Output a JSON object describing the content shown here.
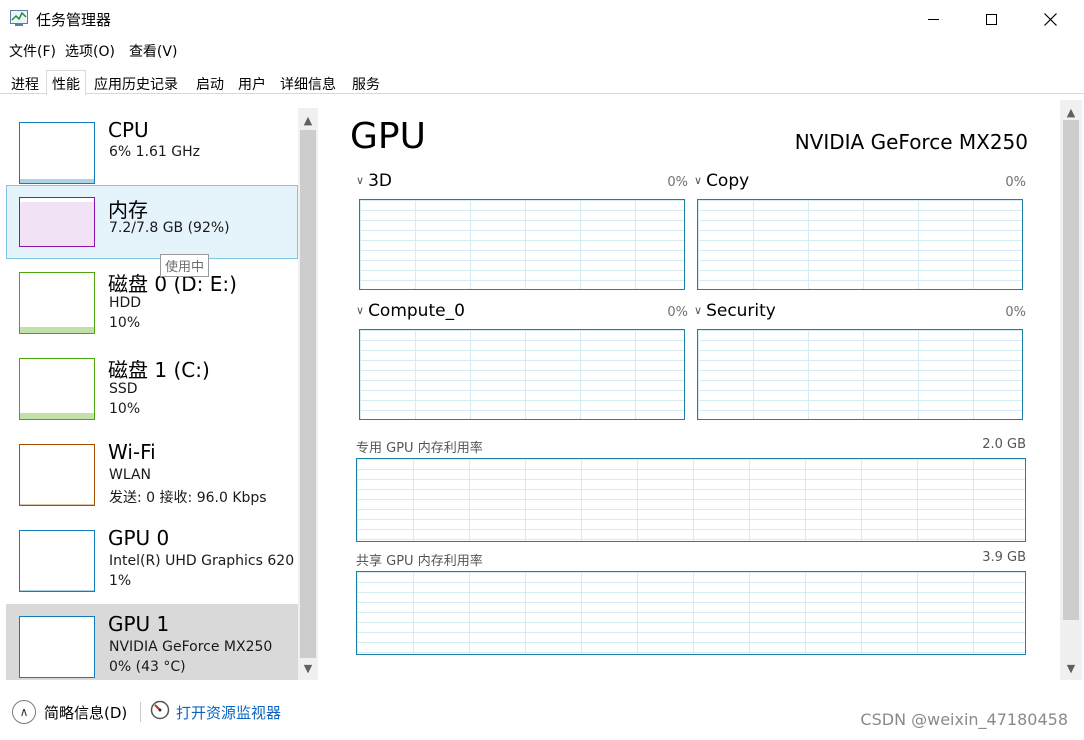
{
  "window": {
    "title": "任务管理器",
    "controls": {
      "minimize_icon": "minimize-icon",
      "maximize_icon": "maximize-icon",
      "close_icon": "close-icon"
    }
  },
  "menu": [
    "文件(F)",
    "选项(O)",
    "查看(V)"
  ],
  "tabs": [
    {
      "label": "进程",
      "active": false
    },
    {
      "label": "性能",
      "active": true
    },
    {
      "label": "应用历史记录",
      "active": false
    },
    {
      "label": "启动",
      "active": false
    },
    {
      "label": "用户",
      "active": false
    },
    {
      "label": "详细信息",
      "active": false
    },
    {
      "label": "服务",
      "active": false
    }
  ],
  "sidebar": {
    "items": [
      {
        "name": "CPU",
        "sub1": "6% 1.61 GHz",
        "sub2": "",
        "color": "#117dbb",
        "state": "normal",
        "level": 0.06
      },
      {
        "name": "内存",
        "sub1": "7.2/7.8 GB (92%)",
        "sub2": "",
        "color": "#8b12ae",
        "state": "hover",
        "level": 0.92
      },
      {
        "name": "磁盘 0 (D: E:)",
        "sub1": "HDD",
        "sub2": "10%",
        "color": "#4da60c",
        "state": "normal",
        "level": 0.1
      },
      {
        "name": "磁盘 1 (C:)",
        "sub1": "SSD",
        "sub2": "10%",
        "color": "#4da60c",
        "state": "normal",
        "level": 0.1
      },
      {
        "name": "Wi-Fi",
        "sub1": "WLAN",
        "sub2": "发送: 0 接收: 96.0 Kbps",
        "color": "#a74f01",
        "state": "normal",
        "level": 0.02
      },
      {
        "name": "GPU 0",
        "sub1": "Intel(R) UHD Graphics 620",
        "sub2": "1%",
        "color": "#117dbb",
        "state": "normal",
        "level": 0.01
      },
      {
        "name": "GPU 1",
        "sub1": "NVIDIA GeForce MX250",
        "sub2": "0% (43 °C)",
        "color": "#117dbb",
        "state": "selected",
        "level": 0
      }
    ],
    "tooltip": "使用中"
  },
  "main": {
    "title": "GPU",
    "model": "NVIDIA GeForce MX250",
    "engines": [
      {
        "label": "3D",
        "percent": "0%"
      },
      {
        "label": "Copy",
        "percent": "0%"
      },
      {
        "label": "Compute_0",
        "percent": "0%"
      },
      {
        "label": "Security",
        "percent": "0%"
      }
    ],
    "dedicated_memory": {
      "label": "专用 GPU 内存利用率",
      "value": "2.0 GB"
    },
    "shared_memory": {
      "label": "共享 GPU 内存利用率",
      "value": "3.9 GB"
    }
  },
  "bottom": {
    "fewer_details": "简略信息(D)",
    "open_resmon": "打开资源监视器"
  },
  "watermark": "CSDN @weixin_47180458"
}
